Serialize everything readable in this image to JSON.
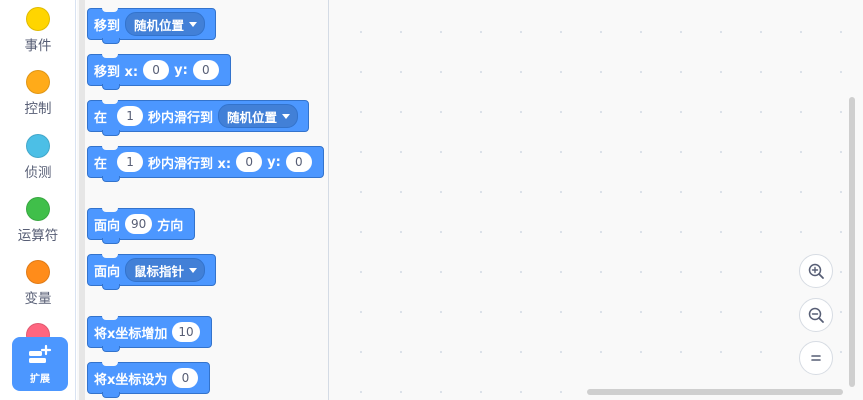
{
  "categories": [
    {
      "label": "事件",
      "color": "#ffd500"
    },
    {
      "label": "控制",
      "color": "#ffab19"
    },
    {
      "label": "侦测",
      "color": "#4cbfe6"
    },
    {
      "label": "运算符",
      "color": "#40bf4a"
    },
    {
      "label": "变量",
      "color": "#ff8c1a"
    },
    {
      "label": "",
      "color": "#ff6680"
    }
  ],
  "extension": {
    "label": "扩展",
    "icon": "extension-blocks-icon"
  },
  "blocks": {
    "b1": {
      "w1": "移到",
      "dropdown": "随机位置"
    },
    "b2": {
      "w1": "移到 x:",
      "x": "0",
      "w2": "y:",
      "y": "0"
    },
    "b3": {
      "w1": "在",
      "secs": "1",
      "w2": "秒内滑行到",
      "dropdown": "随机位置"
    },
    "b4": {
      "w1": "在",
      "secs": "1",
      "w2": "秒内滑行到 x:",
      "x": "0",
      "w3": "y:",
      "y": "0"
    },
    "b5": {
      "w1": "面向",
      "deg": "90",
      "w2": "方向"
    },
    "b6": {
      "w1": "面向",
      "dropdown": "鼠标指针"
    },
    "b7": {
      "w1": "将x坐标增加",
      "val": "10"
    },
    "b8": {
      "w1": "将x坐标设为",
      "val": "0"
    }
  },
  "colors": {
    "motion": "#4c97ff",
    "motion_border": "#3373cc"
  },
  "zoom_controls": [
    "zoom-in-icon",
    "zoom-out-icon",
    "zoom-reset-icon"
  ]
}
